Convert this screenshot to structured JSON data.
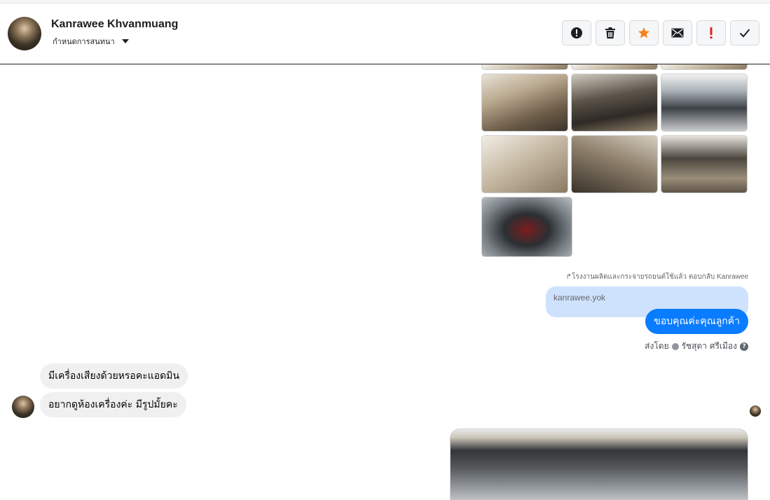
{
  "header": {
    "contact_name": "Kanrawee Khvanmuang",
    "sub_label": "กำหนดการสนทนา",
    "actions": [
      {
        "name": "report-button",
        "icon": "alert-circle-icon",
        "color": "#1c1e21"
      },
      {
        "name": "delete-button",
        "icon": "trash-icon",
        "color": "#1c1e21"
      },
      {
        "name": "star-button",
        "icon": "star-icon",
        "color": "#f5821f"
      },
      {
        "name": "mark-unread-button",
        "icon": "envelope-icon",
        "color": "#1c1e21"
      },
      {
        "name": "important-button",
        "icon": "exclamation-icon",
        "color": "#e02424"
      },
      {
        "name": "done-button",
        "icon": "check-icon",
        "color": "#1c1e21"
      }
    ]
  },
  "thread": {
    "reply_note": "โรงงานผลิตและกระจายรถยนต์ใช้แล้ว ตอบกลับ Kanrawee",
    "quoted_text": "kanrawee.yok",
    "sent_message": "ขอบคุณค่ะคุณลูกค้า",
    "sent_by_prefix": "ส่งโดย",
    "sent_by_name": "รัชสุดา ศรีเมือง",
    "received": [
      {
        "text": "มีเครื่องเสียงด้วยหรอคะแอดมิน"
      },
      {
        "text": "อยากดูห้องเครื่องค่ะ มีรูปมั้ยคะ"
      }
    ]
  },
  "colors": {
    "accent": "#0a7cff",
    "quoted_bg": "#cfe2fd",
    "received_bg": "#f0f0f0"
  }
}
